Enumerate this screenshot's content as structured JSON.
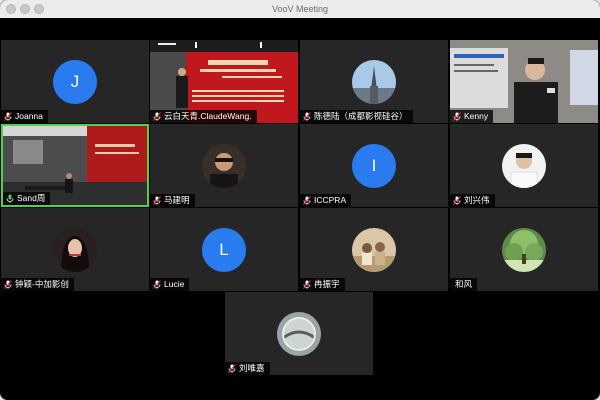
{
  "window": {
    "title": "VooV Meeting"
  },
  "participants": [
    {
      "name": "Joanna",
      "initial": "J",
      "mic": "muted"
    },
    {
      "name": "云白天青.ClaudeWang.",
      "mic": "muted",
      "video_banner": "影视专业知识讲座"
    },
    {
      "name": "陈德陆（成都影视硅谷）",
      "mic": "muted"
    },
    {
      "name": "Kenny",
      "mic": "muted"
    },
    {
      "name": "Sand周",
      "mic": "active",
      "speaking": true
    },
    {
      "name": "马建明",
      "mic": "muted"
    },
    {
      "name": "ICCPRA",
      "initial": "I",
      "mic": "muted"
    },
    {
      "name": "刘兴伟",
      "mic": "muted"
    },
    {
      "name": "钟颖-中加影创",
      "mic": "muted"
    },
    {
      "name": "Lucie",
      "initial": "L",
      "mic": "muted"
    },
    {
      "name": "冉振宇",
      "mic": "muted"
    },
    {
      "name": "和风",
      "mic": "none"
    },
    {
      "name": "刘唯嘉",
      "mic": "muted"
    }
  ],
  "colors": {
    "avatar_blue": "#2b7bf0",
    "speaking_border": "#4fd14f",
    "tile_bg": "#262626",
    "banner_red": "#c0181d"
  }
}
